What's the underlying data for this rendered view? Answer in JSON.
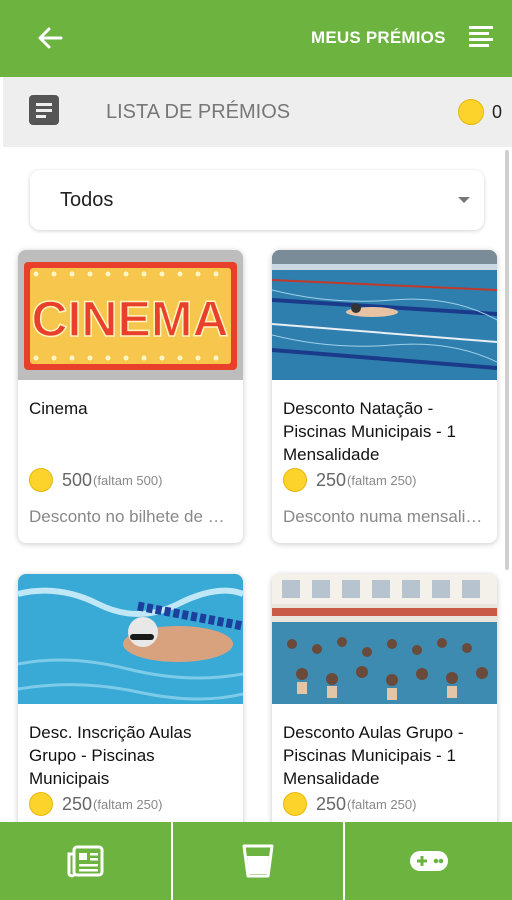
{
  "header": {
    "back_icon": "arrow-left-icon",
    "title": "MEUS PRÉMIOS",
    "menu_icon": "menu-lines-icon",
    "accent_color": "#6db33f"
  },
  "subheader": {
    "icon": "list-icon",
    "title": "LISTA DE PRÉMIOS",
    "coin_icon": "coin-icon",
    "coin_count": "0"
  },
  "filter": {
    "selected": "Todos"
  },
  "prizes": [
    {
      "name": "Cinema",
      "price": "500",
      "missing": "(faltam 500)",
      "description": "Desconto no bilhete de cinema",
      "image_label": "CINEMA"
    },
    {
      "name": "Desconto Natação - Piscinas Municipais - 1 Mensalidade",
      "price": "250",
      "missing": "(faltam 250)",
      "description": "Desconto numa mensalidade de natação"
    },
    {
      "name": "Desc. Inscrição Aulas Grupo - Piscinas Municipais",
      "price": "250",
      "missing": "(faltam 250)",
      "description": ""
    },
    {
      "name": "Desconto Aulas Grupo - Piscinas Municipais - 1 Mensalidade",
      "price": "250",
      "missing": "(faltam 250)",
      "description": ""
    }
  ],
  "bottom_nav": {
    "items": [
      {
        "icon": "newspaper-icon"
      },
      {
        "icon": "cup-icon"
      },
      {
        "icon": "gamepad-icon"
      }
    ]
  }
}
